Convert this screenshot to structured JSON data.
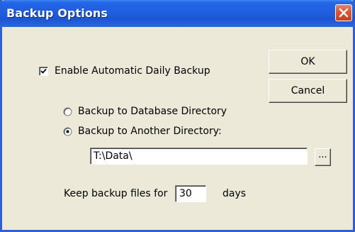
{
  "window": {
    "title": "Backup Options",
    "close_icon": "close-icon"
  },
  "buttons": {
    "ok_label": "OK",
    "cancel_label": "Cancel",
    "browse_label": "..."
  },
  "options": {
    "enable_label": "Enable Automatic Daily Backup",
    "enable_checked": true,
    "radio_db_label": "Backup to Database Directory",
    "radio_db_selected": false,
    "radio_other_label": "Backup to Another Directory:",
    "radio_other_selected": true,
    "directory_value": "T:\\Data\\",
    "keep_label": "Keep backup files for",
    "keep_value": "30",
    "days_label": "days"
  },
  "colors": {
    "titlebar": "#1f5edf",
    "dialog_bg": "#ece9d8",
    "close_button": "#d8532e"
  }
}
